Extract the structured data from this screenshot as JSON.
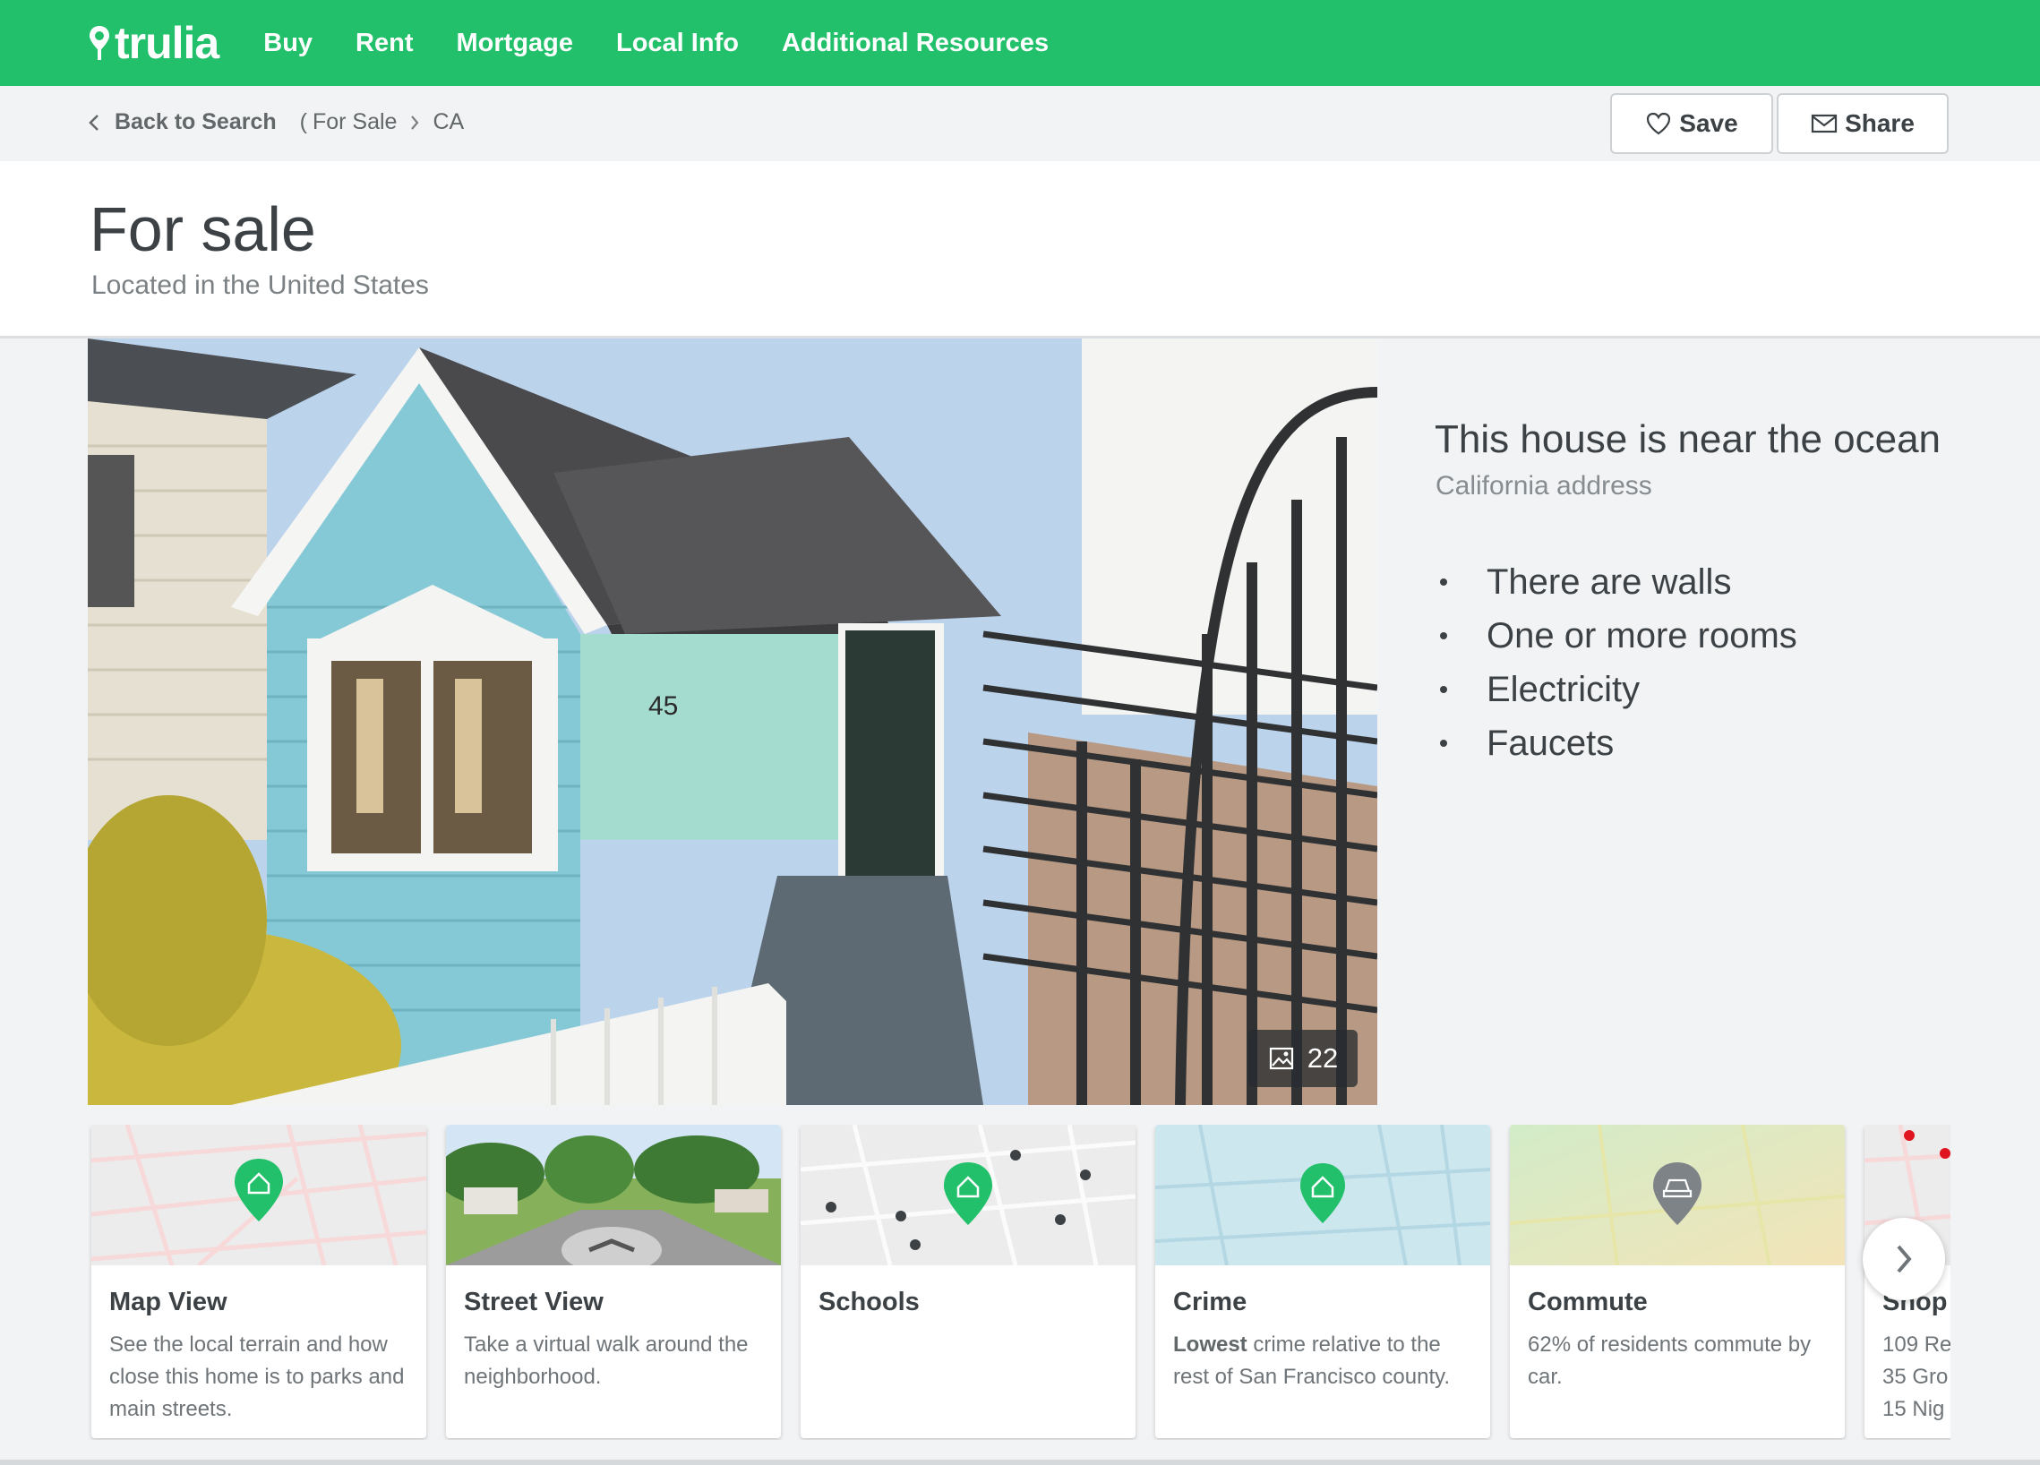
{
  "nav": {
    "logo": "trulia",
    "links": [
      "Buy",
      "Rent",
      "Mortgage",
      "Local Info",
      "Additional Resources"
    ]
  },
  "breadcrumb": {
    "back": "Back to Search",
    "paren": "(",
    "for_sale": "For Sale",
    "state": "CA"
  },
  "actions": {
    "save": "Save",
    "share": "Share"
  },
  "header": {
    "title": "For sale",
    "subtitle": "Located in the United States"
  },
  "gallery": {
    "photo_count": "22",
    "house_number": "45"
  },
  "info": {
    "title": "This house is near the ocean",
    "subtitle": "California address",
    "features": [
      "There are walls",
      "One or more rooms",
      "Electricity",
      "Faucets"
    ]
  },
  "cards": [
    {
      "title": "Map View",
      "text": "See the local terrain and how close this home is to parks and main streets."
    },
    {
      "title": "Street View",
      "text": "Take a virtual walk around the neighborhood."
    },
    {
      "title": "Schools",
      "text": ""
    },
    {
      "title": "Crime",
      "text_bold": "Lowest",
      "text": " crime relative to the rest of San Francisco county."
    },
    {
      "title": "Commute",
      "text": "62% of residents commute by car."
    },
    {
      "title": "Shop",
      "lines": [
        "109 Re",
        "35 Gro",
        "15 Nig"
      ]
    }
  ],
  "colors": {
    "brand": "#22c06a",
    "text": "#3b4144",
    "muted": "#7a8083"
  }
}
